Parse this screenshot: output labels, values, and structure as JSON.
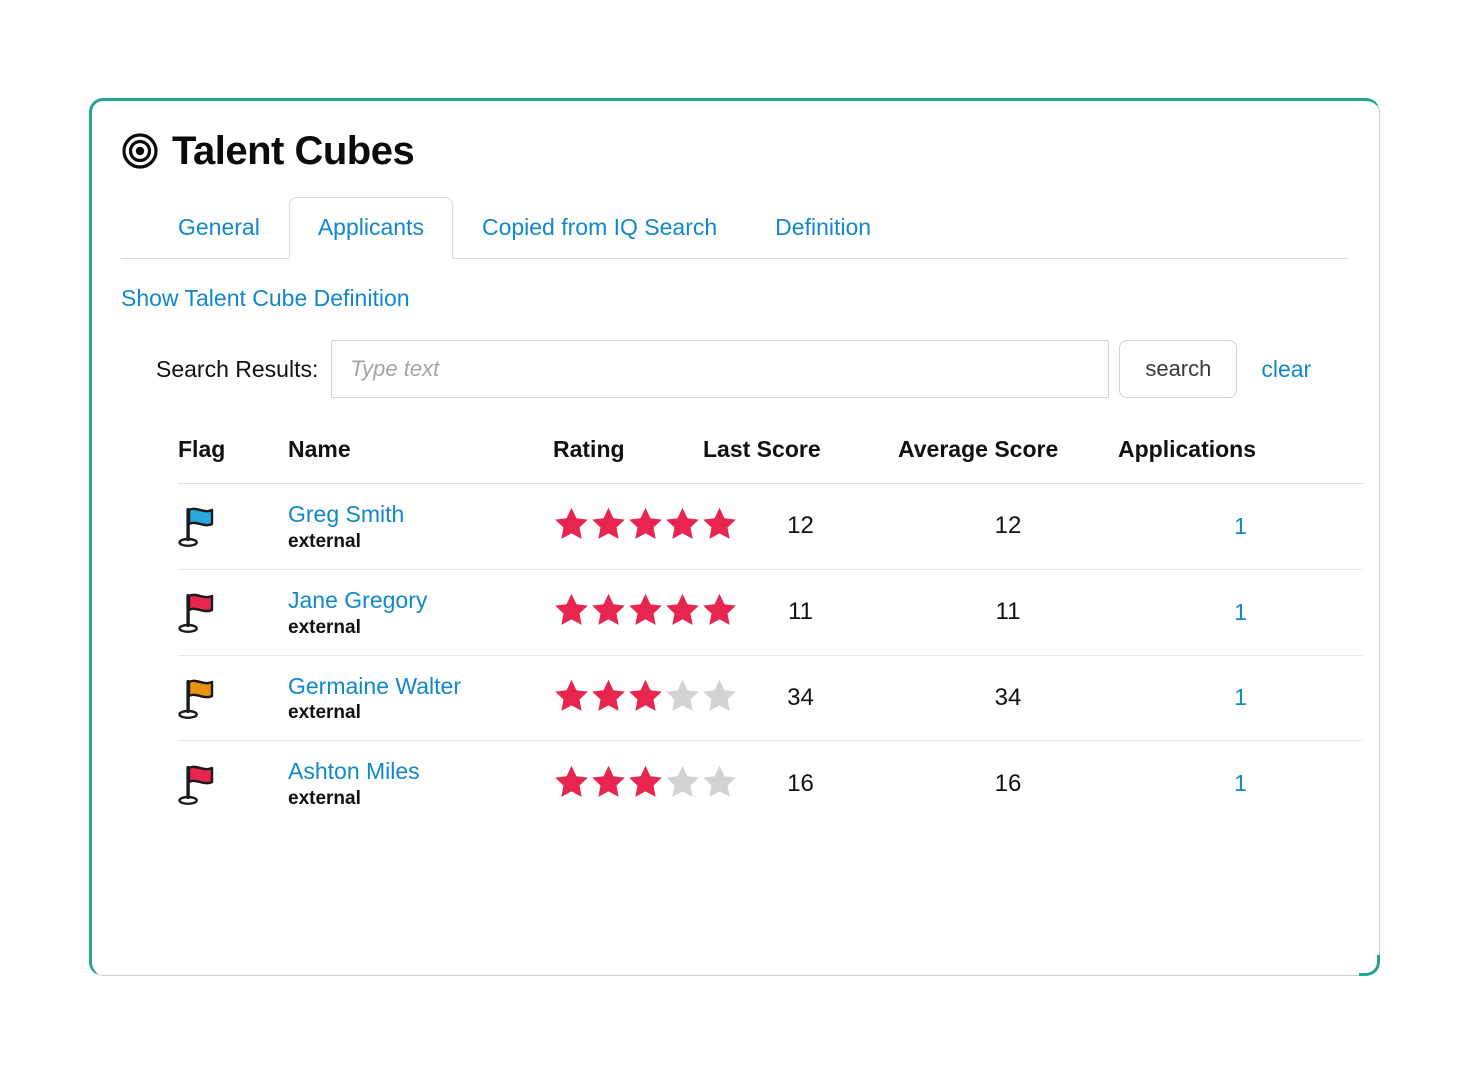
{
  "app": {
    "title": "Talent Cubes",
    "title_icon": "target-icon"
  },
  "colors": {
    "card_accent": "#22a68c",
    "link": "#1288c8",
    "star_filled": "#e8254f",
    "star_empty": "#d3d3d3",
    "flag_blue": "#29a8dd",
    "flag_red": "#e8254f",
    "flag_orange": "#e8930f"
  },
  "tabs": [
    {
      "label": "General",
      "active": false
    },
    {
      "label": "Applicants",
      "active": true
    },
    {
      "label": "Copied from IQ Search",
      "active": false
    },
    {
      "label": "Definition",
      "active": false
    }
  ],
  "definition_link": "Show Talent Cube Definition",
  "search": {
    "label": "Search Results:",
    "value": "",
    "placeholder": "Type text",
    "button_label": "search",
    "clear_label": "clear"
  },
  "table": {
    "headers": [
      "Flag",
      "Name",
      "Rating",
      "Last Score",
      "Average Score",
      "Applications"
    ],
    "rows": [
      {
        "flag_color": "#29a8dd",
        "flag_name": "flag-icon-blue",
        "name": "Greg Smith",
        "source": "external",
        "rating": 5,
        "rating_max": 5,
        "last_score": "12",
        "average_score": "12",
        "applications": "1"
      },
      {
        "flag_color": "#e8254f",
        "flag_name": "flag-icon-red",
        "name": "Jane Gregory",
        "source": "external",
        "rating": 5,
        "rating_max": 5,
        "last_score": "11",
        "average_score": "11",
        "applications": "1"
      },
      {
        "flag_color": "#e8930f",
        "flag_name": "flag-icon-orange",
        "name": "Germaine Walter",
        "source": "external",
        "rating": 3,
        "rating_max": 5,
        "last_score": "34",
        "average_score": "34",
        "applications": "1"
      },
      {
        "flag_color": "#e8254f",
        "flag_name": "flag-icon-red",
        "name": "Ashton Miles",
        "source": "external",
        "rating": 3,
        "rating_max": 5,
        "last_score": "16",
        "average_score": "16",
        "applications": "1"
      }
    ]
  }
}
